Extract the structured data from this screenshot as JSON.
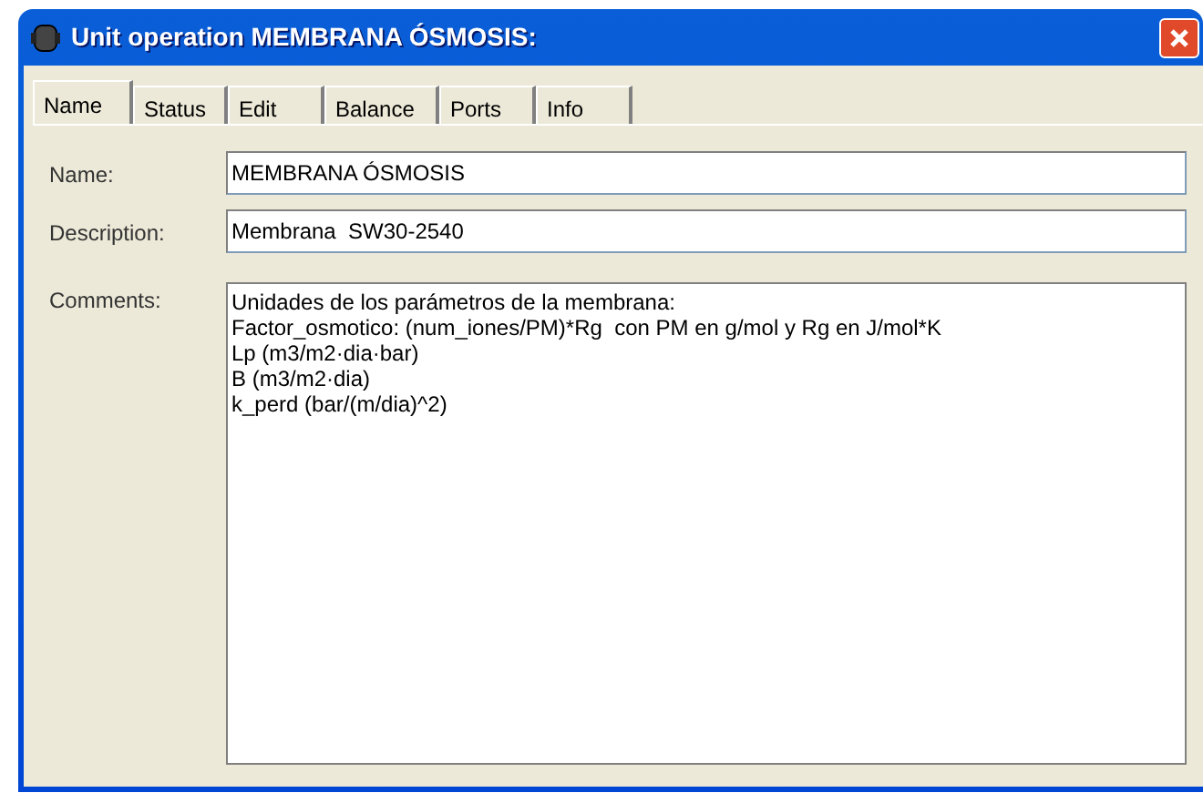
{
  "window": {
    "title": "Unit operation MEMBRANA ÓSMOSIS:"
  },
  "tabs": [
    {
      "label": "Name",
      "selected": true
    },
    {
      "label": "Status",
      "selected": false
    },
    {
      "label": "Edit",
      "selected": false
    },
    {
      "label": "Balance",
      "selected": false
    },
    {
      "label": "Ports",
      "selected": false
    },
    {
      "label": "Info",
      "selected": false
    }
  ],
  "fields": [
    {
      "label": "Name:",
      "value": "MEMBRANA ÓSMOSIS"
    },
    {
      "label": "Description:",
      "value": "Membrana  SW30-2540"
    }
  ],
  "comments": {
    "label": "Comments:",
    "value": "Unidades de los parámetros de la membrana:\nFactor_osmotico: (num_iones/PM)*Rg  con PM en g/mol y Rg en J/mol*K\nLp (m3/m2·dia·bar)\nB (m3/m2·dia)\nk_perd (bar/(m/dia)^2)"
  }
}
